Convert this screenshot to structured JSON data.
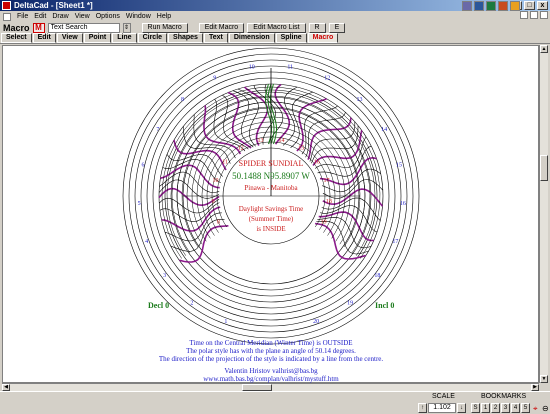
{
  "window": {
    "title": "DeltaCad - [Sheet1 *]"
  },
  "menu": [
    "File",
    "Edit",
    "Draw",
    "View",
    "Options",
    "Window",
    "Help"
  ],
  "toolbar": {
    "macro_label": "Macro",
    "search_placeholder": "Text Search",
    "run_macro": "Run Macro",
    "edit_macro": "Edit Macro",
    "edit_macro_list": "Edit Macro List",
    "r_button": "R",
    "e_button": "E"
  },
  "tabs": [
    "Select",
    "Edit",
    "View",
    "Point",
    "Line",
    "Circle",
    "Shapes",
    "Text",
    "Dimension",
    "Spline",
    "Macro"
  ],
  "active_tab": "Macro",
  "drawing": {
    "title": "SPIDER SUNDIAL",
    "coordinates": "50.1488 N95.8907 W",
    "location": "Pinawa - Manitoba",
    "daylight_line1": "Daylight Savings Time",
    "daylight_line2": "(Summer Time)",
    "daylight_line3": "is INSIDE",
    "decl_label": "Decl 0",
    "incl_label": "Incl 0",
    "outer_hours": [
      "1",
      "2",
      "3",
      "4",
      "5",
      "6",
      "7",
      "8",
      "9",
      "10",
      "11",
      "12",
      "13",
      "14",
      "15",
      "16",
      "17",
      "18",
      "19",
      "20"
    ],
    "inner_hours": [
      "8",
      "9",
      "10",
      "11",
      "12",
      "13",
      "14",
      "15",
      "16",
      "17",
      "18",
      "19"
    ],
    "footer_line1": "Time on the Central Meridian (Winter Time) is OUTSIDE",
    "footer_line2": "The polar style has with the plane an angle of  50.14  degrees.",
    "footer_line3": "The direction of the projection of the style is indicated by a line from the centre.",
    "footer_line4": "Valentin Hristov   valhrist@bas.bg",
    "footer_line5": "www.math.bas.bg/complan/valhrist/mystuff.htm",
    "colors": {
      "blue": "#2020c8",
      "green": "#1a7a1a",
      "red": "#cc2020",
      "purple": "#8b1a8b"
    }
  },
  "status": {
    "scale_label": "SCALE",
    "scale_value": "1.102",
    "bookmarks_label": "BOOKMARKS",
    "bookmarks": [
      "S",
      "1",
      "2",
      "3",
      "4",
      "5"
    ]
  }
}
